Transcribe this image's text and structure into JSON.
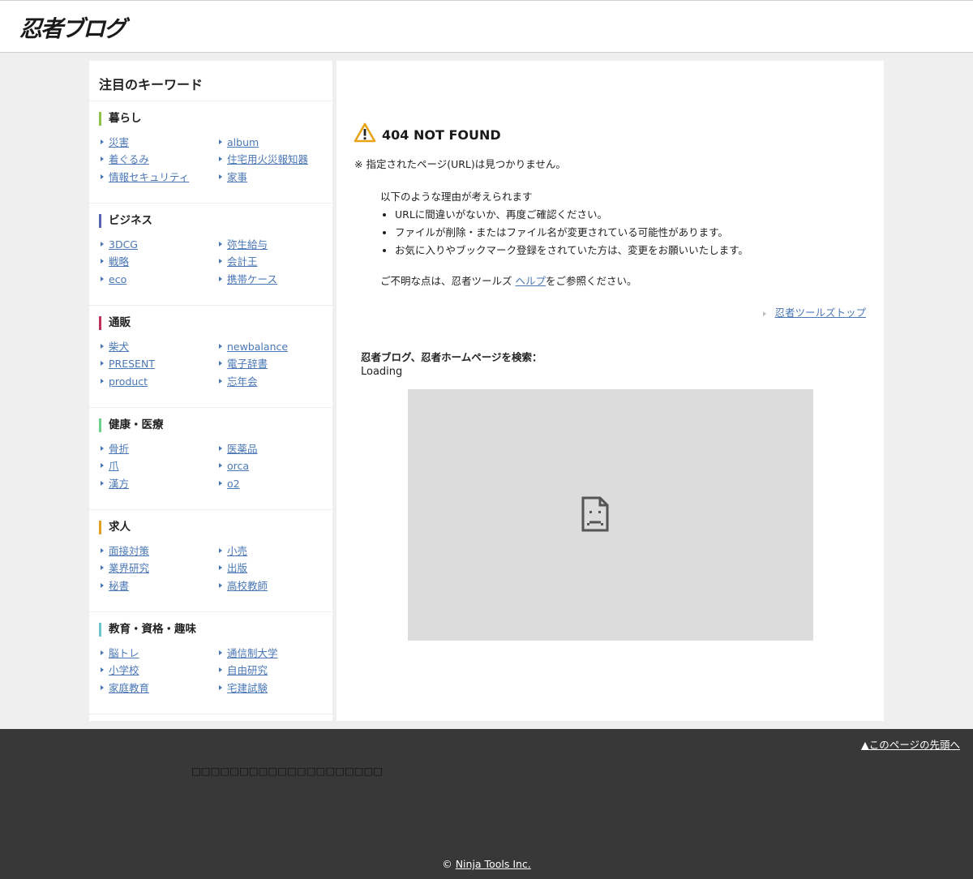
{
  "header": {
    "logo": "忍者ブログ"
  },
  "sidebar": {
    "title": "注目のキーワード",
    "sections": [
      {
        "heading": "暮らし",
        "color": "#8fc24a",
        "items": [
          "災害",
          "album",
          "着ぐるみ",
          "住宅用火災報知器",
          "情報セキュリティ",
          "家事"
        ]
      },
      {
        "heading": "ビジネス",
        "color": "#5563b0",
        "items": [
          "3DCG",
          "弥生給与",
          "戦略",
          "会計王",
          "eco",
          "携帯ケース"
        ]
      },
      {
        "heading": "通販",
        "color": "#c0305a",
        "items": [
          "柴犬",
          "newbalance",
          "PRESENT",
          "電子辞書",
          "product",
          "忘年会"
        ]
      },
      {
        "heading": "健康・医療",
        "color": "#6fd08c",
        "items": [
          "骨折",
          "医薬品",
          "爪",
          "orca",
          "漢方",
          "o2"
        ]
      },
      {
        "heading": "求人",
        "color": "#e3a020",
        "items": [
          "面接対策",
          "小売",
          "業界研究",
          "出版",
          "秘書",
          "高校教師"
        ]
      },
      {
        "heading": "教育・資格・趣味",
        "color": "#6fc4cc",
        "items": [
          "脳トレ",
          "通信制大学",
          "小学校",
          "自由研究",
          "家庭教育",
          "宅建試験"
        ]
      }
    ]
  },
  "main": {
    "title": "404 NOT FOUND",
    "note": "※ 指定されたページ(URL)は見つかりません。",
    "reasons_intro": "以下のような理由が考えられます",
    "reasons": [
      "URLに間違いがないか、再度ご確認ください。",
      "ファイルが削除・またはファイル名が変更されている可能性があります。",
      "お気に入りやブックマーク登録をされていた方は、変更をお願いいたします。"
    ],
    "help_prefix": "ご不明な点は、忍者ツールズ ",
    "help_link": "ヘルプ",
    "help_suffix": "をご参照ください。",
    "tools_top": "忍者ツールズトップ",
    "search_label": "忍者ブログ、忍者ホームページを検索：",
    "loading": "Loading"
  },
  "footer": {
    "page_top": "▲このページの先頭へ",
    "garbled": "□□□□□□□□□□□□□□□□□□□□",
    "copyright_symbol": "© ",
    "copyright_link": "Ninja Tools Inc."
  },
  "colors": {
    "link": "#4a77b5",
    "warning": "#e8a317",
    "footer_bg": "#383838"
  }
}
